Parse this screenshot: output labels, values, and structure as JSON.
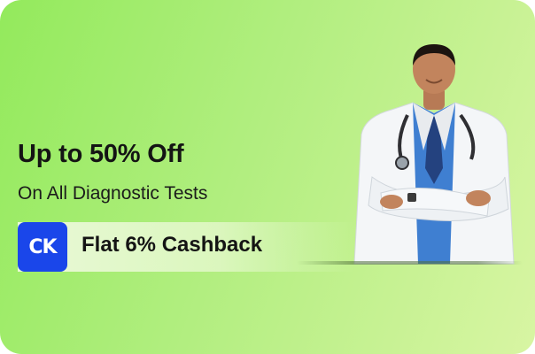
{
  "offer": {
    "headline": "Up to 50% Off",
    "subline": "On All Diagnostic Tests"
  },
  "cashback": {
    "badge_text": "CK",
    "label": "Flat 6% Cashback"
  },
  "colors": {
    "background_start": "#93ea5c",
    "background_end": "#d8f5a3",
    "badge": "#1a46ea",
    "text": "#141414"
  },
  "icons": {
    "badge_icon": "ck-logo-icon",
    "hero_image": "doctor-illustration"
  }
}
